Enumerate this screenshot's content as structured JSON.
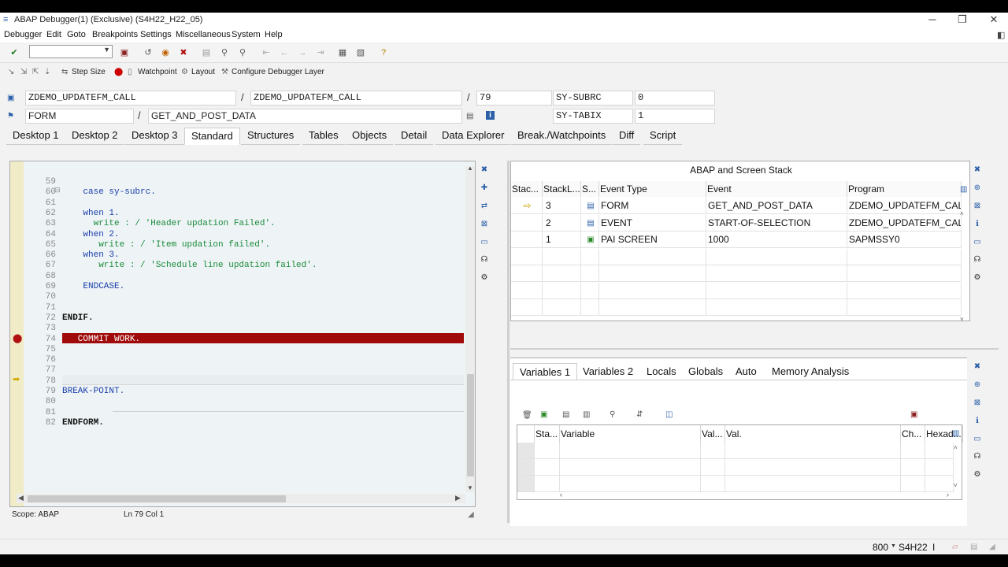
{
  "window": {
    "title": "ABAP Debugger(1)  (Exclusive) (S4H22_H22_05)",
    "minimize": "─",
    "maximize": "❐",
    "close": "✕"
  },
  "menu": [
    "Debugger",
    "Edit",
    "Goto",
    "Breakpoints",
    "Settings",
    "Miscellaneous",
    "System",
    "Help"
  ],
  "toolbar": {
    "command_value": "",
    "dropdown": "▼"
  },
  "app_toolbar": {
    "step_size": "Step Size",
    "watchpoint": "Watchpoint",
    "layout": "Layout",
    "configure": "Configure Debugger Layer"
  },
  "header": {
    "program1": "ZDEMO_UPDATEFM_CALL",
    "program2": "ZDEMO_UPDATEFM_CALL",
    "line": "79",
    "sy_subrc_label": "SY-SUBRC",
    "sy_subrc_value": "0",
    "event_type": "FORM",
    "event": "GET_AND_POST_DATA",
    "sy_tabix_label": "SY-TABIX",
    "sy_tabix_value": "1",
    "slash": "/"
  },
  "tabs": [
    "Desktop 1",
    "Desktop 2",
    "Desktop 3",
    "Standard",
    "Structures",
    "Tables",
    "Objects",
    "Detail",
    "Data Explorer",
    "Break./Watchpoints",
    "Diff",
    "Script"
  ],
  "active_tab": "Standard",
  "source": {
    "lines": [
      {
        "no": "59",
        "text": ""
      },
      {
        "no": "60",
        "text": "    case sy-subrc."
      },
      {
        "no": "61",
        "text": ""
      },
      {
        "no": "62",
        "text": "    when 1."
      },
      {
        "no": "63",
        "text": "      write : / 'Header updation Failed'."
      },
      {
        "no": "64",
        "text": "    when 2."
      },
      {
        "no": "65",
        "text": "       write : / 'Item updation failed'."
      },
      {
        "no": "66",
        "text": "    when 3."
      },
      {
        "no": "67",
        "text": "       write : / 'Schedule line updation failed'."
      },
      {
        "no": "68",
        "text": ""
      },
      {
        "no": "69",
        "text": "    ENDCASE."
      },
      {
        "no": "70",
        "text": ""
      },
      {
        "no": "71",
        "text": ""
      },
      {
        "no": "72",
        "text": "ENDIF."
      },
      {
        "no": "73",
        "text": ""
      },
      {
        "no": "74",
        "text": "   COMMIT WORK."
      },
      {
        "no": "75",
        "text": ""
      },
      {
        "no": "76",
        "text": ""
      },
      {
        "no": "77",
        "text": ""
      },
      {
        "no": "78",
        "text": ""
      },
      {
        "no": "79",
        "text": "BREAK-POINT."
      },
      {
        "no": "80",
        "text": ""
      },
      {
        "no": "81",
        "text": ""
      },
      {
        "no": "82",
        "text": "ENDFORM."
      }
    ],
    "scope": "Scope: ABAP",
    "position": "Ln 79 Col  1"
  },
  "stack": {
    "title": "ABAP and Screen Stack",
    "columns": [
      "Stac...",
      "StackL...",
      "S...",
      "Event Type",
      "Event",
      "Program"
    ],
    "rows": [
      {
        "level": "3",
        "event_type": "FORM",
        "event": "GET_AND_POST_DATA",
        "program": "ZDEMO_UPDATEFM_CALL"
      },
      {
        "level": "2",
        "event_type": "EVENT",
        "event": "START-OF-SELECTION",
        "program": "ZDEMO_UPDATEFM_CALL"
      },
      {
        "level": "1",
        "event_type": "PAI SCREEN",
        "event": "1000",
        "program": "SAPMSSY0"
      }
    ]
  },
  "variables": {
    "tabs": [
      "Variables 1",
      "Variables 2",
      "Locals",
      "Globals",
      "Auto",
      "Memory Analysis"
    ],
    "active_tab": "Variables 1",
    "columns": [
      "Sta...",
      "Variable",
      "Val...",
      "Val.",
      "Ch...",
      "Hexad..."
    ]
  },
  "statusbar": {
    "client": "800",
    "system": "S4H22",
    "mode": "I"
  },
  "colors": {
    "breakpoint_line": "#a00a0a",
    "keyword": "#1a3da8",
    "string": "#1a8a3a"
  }
}
